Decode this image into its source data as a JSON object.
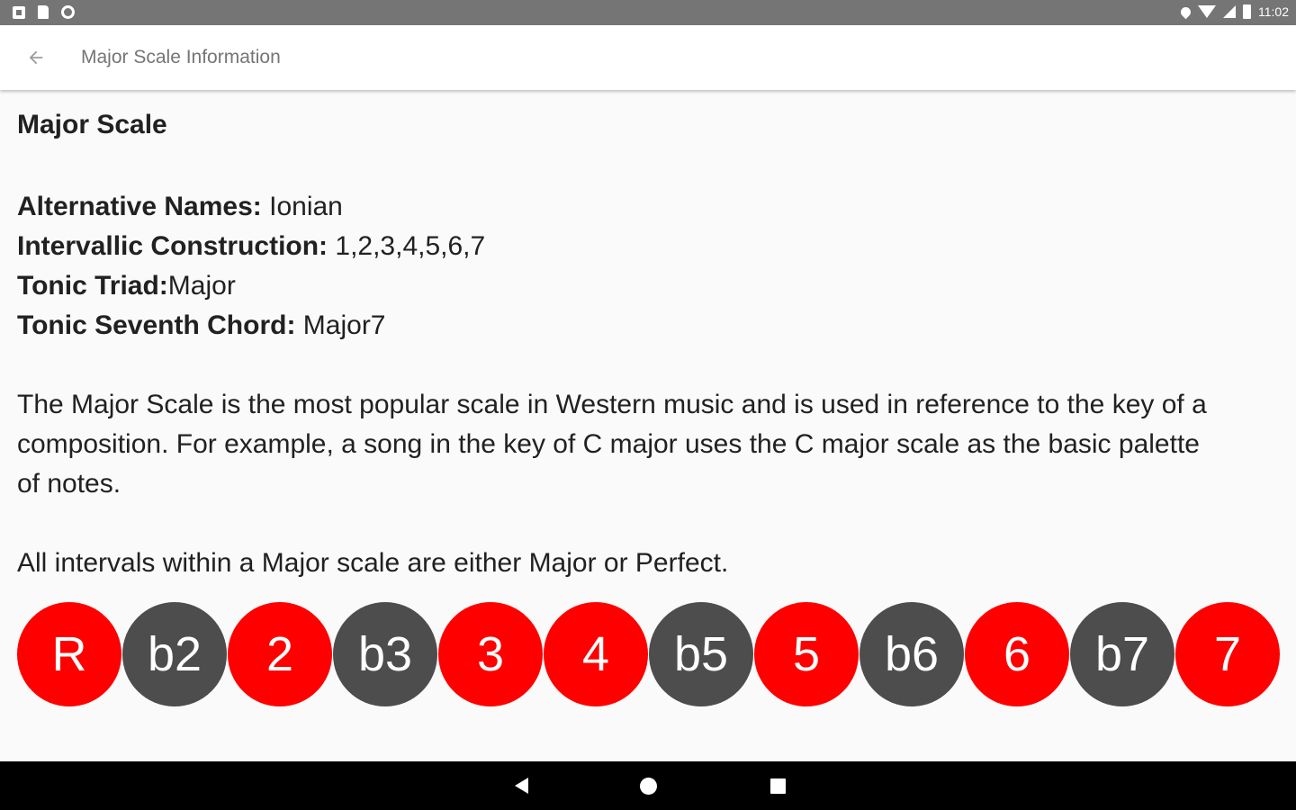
{
  "status_bar": {
    "left_icons": [
      "notification-square-icon",
      "sd-card-icon",
      "sync-circle-icon"
    ],
    "right_icons": [
      "location-icon",
      "wifi-icon",
      "signal-icon",
      "battery-icon"
    ],
    "time": "11:02"
  },
  "app_bar": {
    "back_icon": "arrow-left-icon",
    "title": "Major Scale Information"
  },
  "content": {
    "heading": "Major Scale",
    "properties": [
      {
        "label": "Alternative Names:",
        "value": " Ionian"
      },
      {
        "label": "Intervallic Construction:",
        "value": " 1,2,3,4,5,6,7"
      },
      {
        "label": "Tonic Triad:",
        "value": "Major"
      },
      {
        "label": "Tonic Seventh Chord:",
        "value": " Major7"
      }
    ],
    "description": "The Major Scale is the most popular scale in Western music and is used in reference to the key of a composition. For example, a song in the key of C major uses the C major scale as the basic palette of notes.",
    "note": "All intervals within a Major scale are either Major or Perfect."
  },
  "intervals": [
    {
      "label": "R",
      "in_scale": true
    },
    {
      "label": "b2",
      "in_scale": false
    },
    {
      "label": "2",
      "in_scale": true
    },
    {
      "label": "b3",
      "in_scale": false
    },
    {
      "label": "3",
      "in_scale": true
    },
    {
      "label": "4",
      "in_scale": true
    },
    {
      "label": "b5",
      "in_scale": false
    },
    {
      "label": "5",
      "in_scale": true
    },
    {
      "label": "b6",
      "in_scale": false
    },
    {
      "label": "6",
      "in_scale": true
    },
    {
      "label": "b7",
      "in_scale": false
    },
    {
      "label": "7",
      "in_scale": true
    }
  ],
  "colors": {
    "in_scale": "#ff0000",
    "out_of_scale": "#4d4d4d",
    "status_bar": "#757575",
    "nav_bar": "#000000"
  },
  "nav_bar": {
    "icons": [
      "nav-back-icon",
      "nav-home-icon",
      "nav-recents-icon"
    ]
  }
}
